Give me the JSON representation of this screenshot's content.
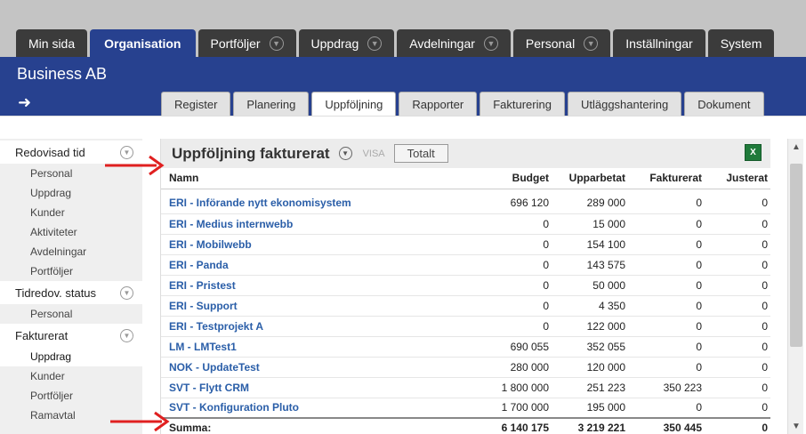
{
  "main_tabs": [
    {
      "label": "Min sida",
      "dropdown": false,
      "active": false
    },
    {
      "label": "Organisation",
      "dropdown": false,
      "active": true
    },
    {
      "label": "Portföljer",
      "dropdown": true,
      "active": false
    },
    {
      "label": "Uppdrag",
      "dropdown": true,
      "active": false
    },
    {
      "label": "Avdelningar",
      "dropdown": true,
      "active": false
    },
    {
      "label": "Personal",
      "dropdown": true,
      "active": false
    },
    {
      "label": "Inställningar",
      "dropdown": false,
      "active": false
    },
    {
      "label": "System",
      "dropdown": false,
      "active": false
    }
  ],
  "header": {
    "company": "Business AB",
    "back_icon": "arrow-left-icon"
  },
  "sub_tabs": [
    {
      "label": "Register",
      "active": false
    },
    {
      "label": "Planering",
      "active": false
    },
    {
      "label": "Uppföljning",
      "active": true
    },
    {
      "label": "Rapporter",
      "active": false
    },
    {
      "label": "Fakturering",
      "active": false
    },
    {
      "label": "Utläggshantering",
      "active": false
    },
    {
      "label": "Dokument",
      "active": false
    }
  ],
  "sidebar": {
    "sections": [
      {
        "title": "Redovisad tid",
        "items": [
          "Personal",
          "Uppdrag",
          "Kunder",
          "Aktiviteter",
          "Avdelningar",
          "Portföljer"
        ]
      },
      {
        "title": "Tidredov. status",
        "items": [
          "Personal"
        ]
      },
      {
        "title": "Fakturerat",
        "items": [
          "Uppdrag",
          "Kunder",
          "Portföljer",
          "Ramavtal"
        ]
      }
    ],
    "active_item": "Fakturerat.Uppdrag"
  },
  "panel": {
    "title": "Uppföljning fakturerat",
    "visa_label": "VISA",
    "view_button": "Totalt",
    "export_icon": "excel-icon",
    "columns": [
      "Namn",
      "Budget",
      "Upparbetat",
      "Fakturerat",
      "Justerat"
    ],
    "rows": [
      [
        "ERI - Införande nytt ekonomisystem",
        "696 120",
        "289 000",
        "0",
        "0"
      ],
      [
        "ERI - Medius internwebb",
        "0",
        "15 000",
        "0",
        "0"
      ],
      [
        "ERI - Mobilwebb",
        "0",
        "154 100",
        "0",
        "0"
      ],
      [
        "ERI - Panda",
        "0",
        "143 575",
        "0",
        "0"
      ],
      [
        "ERI - Pristest",
        "0",
        "50 000",
        "0",
        "0"
      ],
      [
        "ERI - Support",
        "0",
        "4 350",
        "0",
        "0"
      ],
      [
        "ERI - Testprojekt A",
        "0",
        "122 000",
        "0",
        "0"
      ],
      [
        "LM - LMTest1",
        "690 055",
        "352 055",
        "0",
        "0"
      ],
      [
        "NOK - UpdateTest",
        "280 000",
        "120 000",
        "0",
        "0"
      ],
      [
        "SVT - Flytt CRM",
        "1 800 000",
        "251 223",
        "350 223",
        "0"
      ],
      [
        "SVT - Konfiguration Pluto",
        "1 700 000",
        "195 000",
        "0",
        "0"
      ]
    ],
    "summary": [
      "Summa:",
      "6 140 175",
      "3 219 221",
      "350 445",
      "0"
    ]
  },
  "annotation_color": "#e02020"
}
